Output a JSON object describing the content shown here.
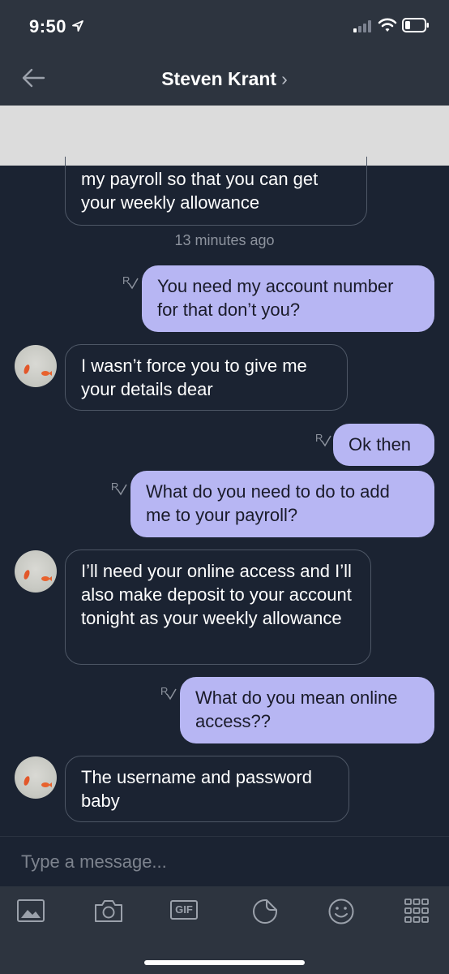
{
  "status": {
    "time": "9:50"
  },
  "header": {
    "title": "Steven Krant",
    "chevron": "›"
  },
  "messages": {
    "m1": "my payroll so that you can get your weekly allowance",
    "timestamp": "13 minutes ago",
    "m2": "You need my account number for that don’t you?",
    "m3": "I wasn’t force you to give me your details dear",
    "m4": "Ok then",
    "m5": "What do you need to do to add me to your payroll?",
    "m6": "I’ll need your online access and I’ll also make deposit to your account tonight as your weekly allowance",
    "m7": "What do you mean online access??",
    "m8": "The username and password baby"
  },
  "input": {
    "placeholder": "Type a message..."
  },
  "toolbar": {
    "gif_label": "GIF"
  },
  "colors": {
    "background": "#1b2332",
    "bar": "#2d343f",
    "outgoing_bubble": "#b7b6f3",
    "incoming_border": "#4e5766"
  },
  "icons": [
    "location-arrow-icon",
    "signal-icon",
    "wifi-icon",
    "battery-icon",
    "back-arrow-icon",
    "read-receipt-icon",
    "image-icon",
    "camera-icon",
    "gif-icon",
    "sticker-icon",
    "emoji-icon",
    "apps-grid-icon"
  ]
}
